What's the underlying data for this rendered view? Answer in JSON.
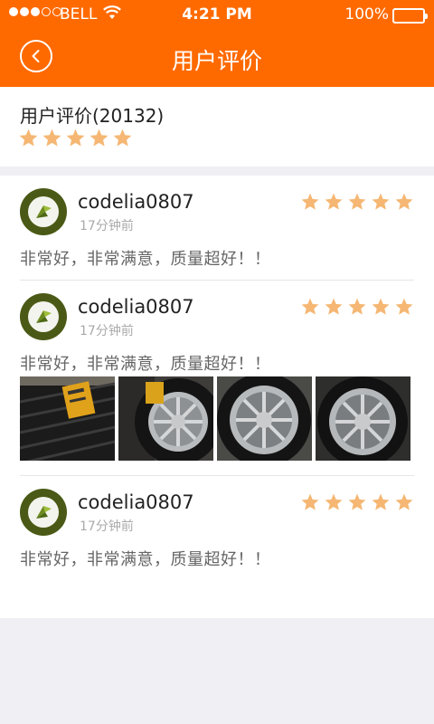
{
  "status_bar": {
    "carrier": "BELL",
    "time": "4:21 PM",
    "battery": "100%"
  },
  "header": {
    "title": "用户评价",
    "back_icon": "chevron-left-icon"
  },
  "summary": {
    "title": "用户评价(20132)",
    "rating": 5,
    "star_color": "#f5b773"
  },
  "reviews": [
    {
      "username": "codelia0807",
      "time_ago": "17分钟前",
      "rating": 5,
      "text": "非常好，非常满意，质量超好！！",
      "photo_count": 0
    },
    {
      "username": "codelia0807",
      "time_ago": "17分钟前",
      "rating": 5,
      "text": "非常好，非常满意，质量超好！！",
      "photo_count": 4
    },
    {
      "username": "codelia0807",
      "time_ago": "17分钟前",
      "rating": 5,
      "text": "非常好，非常满意，质量超好！！",
      "photo_count": 0
    }
  ],
  "colors": {
    "accent": "#ff6a00",
    "star": "#f5b773",
    "background": "#efeff4"
  }
}
